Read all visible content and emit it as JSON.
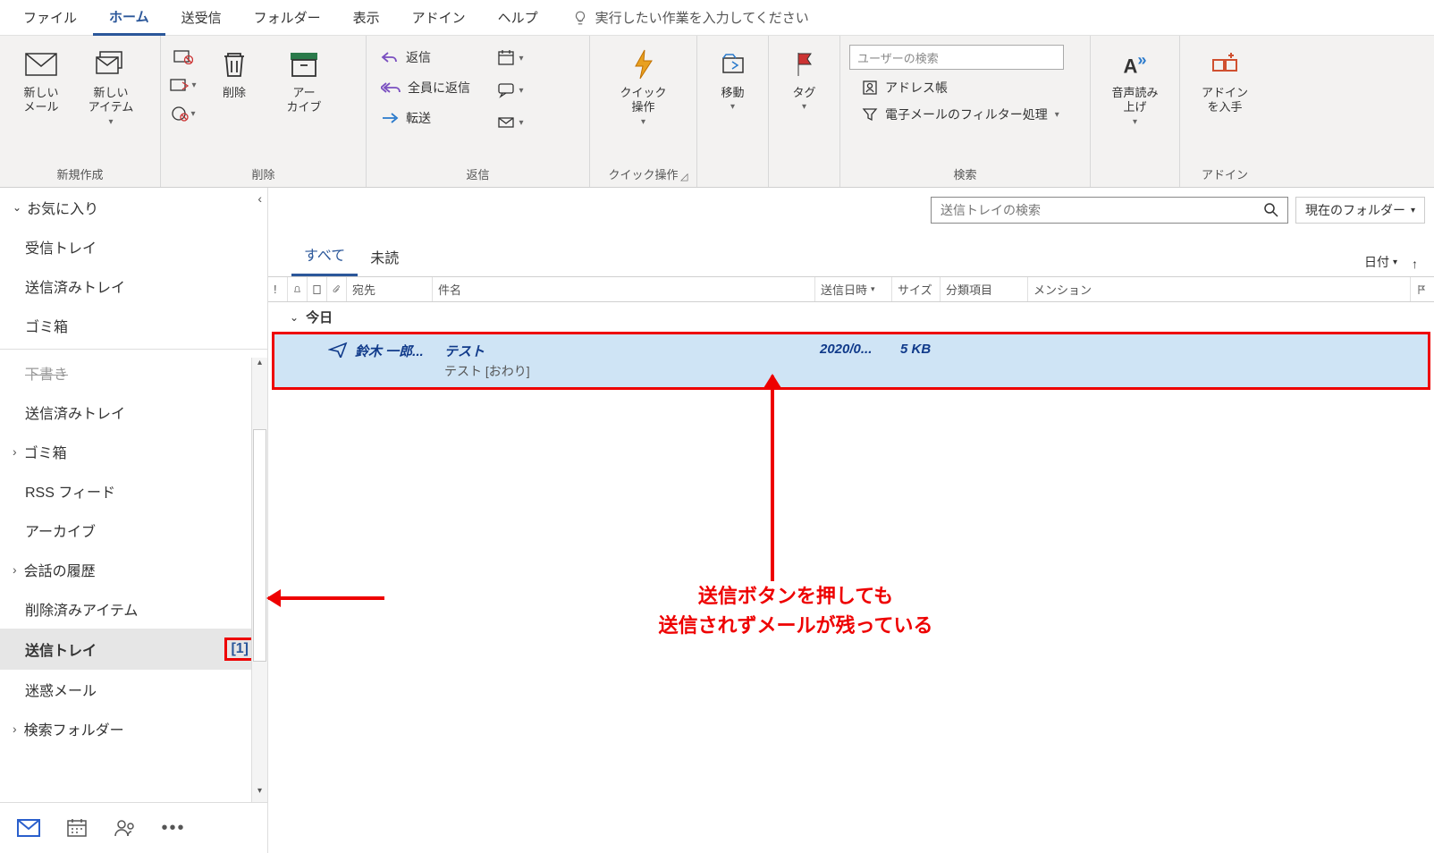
{
  "menu": {
    "tabs": [
      "ファイル",
      "ホーム",
      "送受信",
      "フォルダー",
      "表示",
      "アドイン",
      "ヘルプ"
    ],
    "active_index": 1,
    "tell_me": "実行したい作業を入力してください"
  },
  "ribbon": {
    "groups": {
      "new": {
        "label": "新規作成",
        "new_mail": "新しい\nメール",
        "new_item": "新しい\nアイテム"
      },
      "delete": {
        "label": "削除",
        "delete": "削除",
        "archive": "アー\nカイブ"
      },
      "reply": {
        "label": "返信",
        "reply": "返信",
        "reply_all": "全員に返信",
        "forward": "転送"
      },
      "quick": {
        "label": "クイック操作",
        "quick": "クイック\n操作"
      },
      "move": {
        "label": "",
        "move": "移動"
      },
      "tag": {
        "label": "",
        "tag": "タグ"
      },
      "search": {
        "label": "検索",
        "user_search_ph": "ユーザーの検索",
        "address_book": "アドレス帳",
        "filter": "電子メールのフィルター処理"
      },
      "speech": {
        "label": "",
        "speech": "音声読み\n上げ"
      },
      "addin": {
        "label": "アドイン",
        "addin": "アドイン\nを入手"
      }
    }
  },
  "nav": {
    "favorites": "お気に入り",
    "fav_items": [
      "受信トレイ",
      "送信済みトレイ",
      "ゴミ箱"
    ],
    "folders": [
      {
        "label": "下書き",
        "type": "sub"
      },
      {
        "label": "送信済みトレイ",
        "type": "sub"
      },
      {
        "label": "ゴミ箱",
        "type": "parent"
      },
      {
        "label": "RSS フィード",
        "type": "sub"
      },
      {
        "label": "アーカイブ",
        "type": "sub"
      },
      {
        "label": "会話の履歴",
        "type": "parent"
      },
      {
        "label": "削除済みアイテム",
        "type": "sub"
      },
      {
        "label": "送信トレイ",
        "type": "sub",
        "selected": true,
        "count": "[1]"
      },
      {
        "label": "迷惑メール",
        "type": "sub"
      },
      {
        "label": "検索フォルダー",
        "type": "parent"
      }
    ]
  },
  "list": {
    "search_ph": "送信トレイの検索",
    "scope": "現在のフォルダー",
    "filter_all": "すべて",
    "filter_unread": "未読",
    "sort_by": "日付",
    "cols": {
      "to": "宛先",
      "subject": "件名",
      "sent": "送信日時",
      "size": "サイズ",
      "category": "分類項目",
      "mention": "メンション"
    },
    "group": "今日",
    "msg": {
      "to": "鈴木 一郎...",
      "subject": "テスト",
      "preview": "テスト [おわり]",
      "date": "2020/0...",
      "size": "5 KB"
    }
  },
  "annotation": {
    "line1": "送信ボタンを押しても",
    "line2": "送信されずメールが残っている"
  }
}
